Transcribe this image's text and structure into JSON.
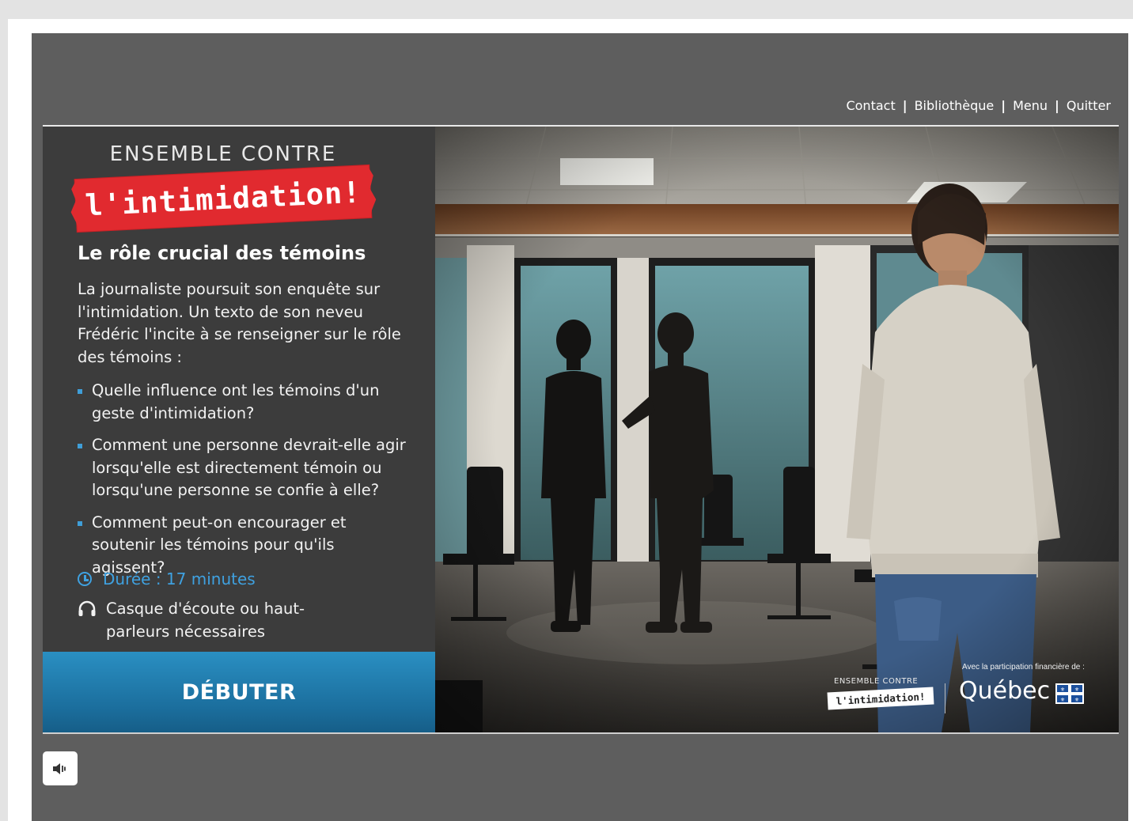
{
  "nav": {
    "contact": "Contact",
    "library": "Bibliothèque",
    "menu": "Menu",
    "quit": "Quitter",
    "separator": "|"
  },
  "panel": {
    "brand_top": "ENSEMBLE CONTRE",
    "brand_banner": "l'intimidation!",
    "title": "Le rôle crucial des témoins",
    "intro": "La journaliste poursuit son enquête sur l'intimidation. Un texto de son neveu Frédéric l'incite à se renseigner sur le rôle des témoins :",
    "questions": [
      "Quelle influence ont les témoins d'un geste d'intimidation?",
      "Comment une personne devrait-elle agir lorsqu'elle est directement témoin ou lorsqu'une personne se confie à elle?",
      "Comment peut-on encourager et soutenir les témoins pour qu'ils agissent?"
    ],
    "duration": "Durée : 17 minutes",
    "headset": "Casque d'écoute ou haut-parleurs nécessaires",
    "start_button": "DÉBUTER"
  },
  "footer_logos": {
    "ensemble": "ENSEMBLE CONTRE",
    "badge": "l'intimidation!",
    "funding": "Avec la participation financière de :",
    "quebec": "Québec"
  },
  "icons": {
    "clock": "clock-icon",
    "headset": "headset-icon",
    "audio": "speaker-icon"
  },
  "colors": {
    "player_bg": "#5e5e5e",
    "panel_bg": "#3c3c3c",
    "accent_blue": "#3fa1e0",
    "brand_red": "#e12a2f",
    "button_blue": "#1b6e9d"
  }
}
